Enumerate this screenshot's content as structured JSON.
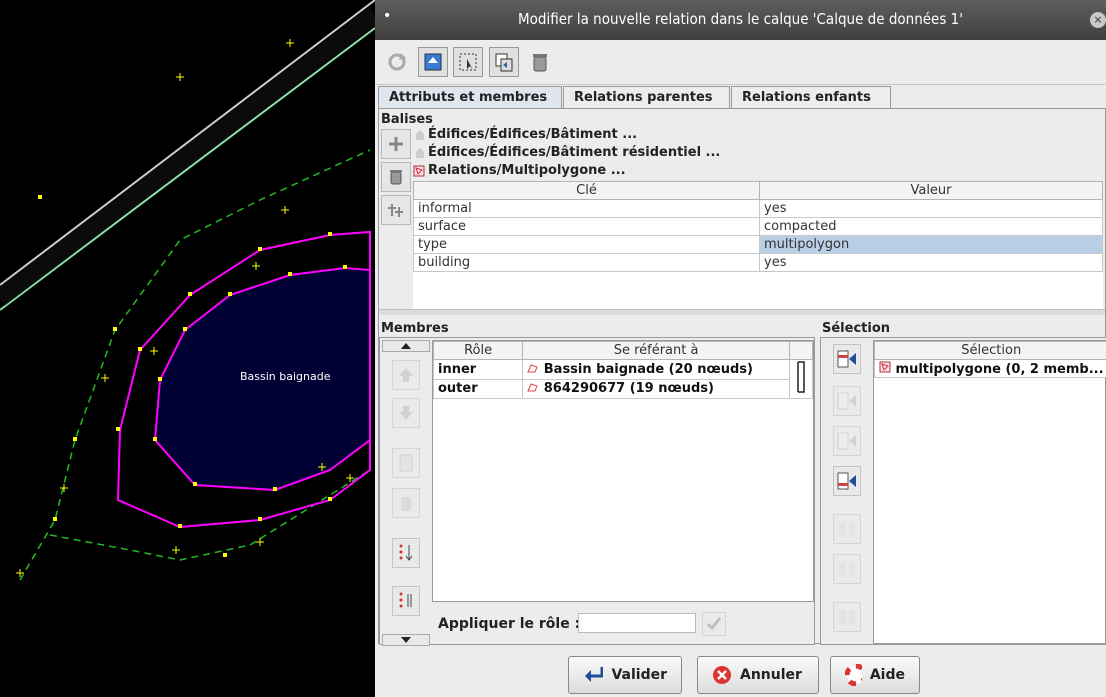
{
  "map": {
    "area_label": "Bassin baignade"
  },
  "dialog": {
    "title": "Modifier la nouvelle relation dans le calque 'Calque de données 1'",
    "tabs": [
      "Attributs et membres",
      "Relations parentes",
      "Relations enfants"
    ],
    "tags": {
      "title": "Balises",
      "presets": [
        "Édifices/Édifices/Bâtiment ...",
        "Édifices/Édifices/Bâtiment résidentiel ...",
        "Relations/Multipolygone ..."
      ],
      "headers": [
        "Clé",
        "Valeur"
      ],
      "rows": [
        {
          "key": "informal",
          "value": "yes"
        },
        {
          "key": "surface",
          "value": "compacted"
        },
        {
          "key": "type",
          "value": "multipolygon"
        },
        {
          "key": "building",
          "value": "yes"
        }
      ]
    },
    "members": {
      "title": "Membres",
      "headers": [
        "Rôle",
        "Se référant à"
      ],
      "rows": [
        {
          "role": "inner",
          "ref": "Bassin baignade (20 nœuds)"
        },
        {
          "role": "outer",
          "ref": "864290677 (19 nœuds)"
        }
      ],
      "apply_role_label": "Appliquer le rôle :",
      "apply_role_value": ""
    },
    "selection": {
      "title": "Sélection",
      "header": "Sélection",
      "rows": [
        "multipolygone (0, 2 memb..."
      ]
    },
    "buttons": {
      "ok": "Valider",
      "cancel": "Annuler",
      "help": "Aide"
    }
  },
  "colors": {
    "polygon": "#ff00ff",
    "area_fill": "#000033",
    "dashed_way": "#22bb22",
    "selection_row": "#b8cfe5"
  }
}
